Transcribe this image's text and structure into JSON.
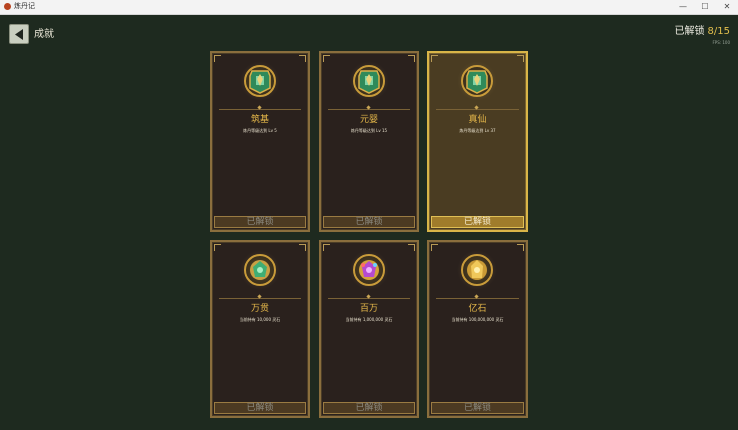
{
  "window": {
    "title": "炼丹记",
    "minimize_glyph": "—",
    "maximize_glyph": "☐",
    "close_glyph": "✕"
  },
  "header": {
    "title": "成就",
    "back_icon": "back-arrow-icon",
    "unlocked_label": "已解锁",
    "unlocked_count": "8/15",
    "fps": "FPS: 100"
  },
  "colors": {
    "background": "#1e2a1f",
    "gold": "#e2bf4d",
    "card_border": "#8a6e3d",
    "highlight_border": "#d9b548"
  },
  "achievements": [
    {
      "name": "筑基",
      "desc": "炼丹等级达到 Lv 5",
      "status": "已解锁",
      "icon": "medal-jade-icon"
    },
    {
      "name": "元婴",
      "desc": "炼丹等级达到 Lv 15",
      "status": "已解锁",
      "icon": "medal-jade-icon"
    },
    {
      "name": "真仙",
      "desc": "炼丹等级达到 Lv 37",
      "status": "已解锁",
      "icon": "medal-jade-icon"
    },
    {
      "name": "万贯",
      "desc": "当前持有 10,000 灵石",
      "status": "已解锁",
      "icon": "medal-jade-gem-icon"
    },
    {
      "name": "百万",
      "desc": "当前持有 1,000,000 灵石",
      "status": "已解锁",
      "icon": "medal-purple-gem-icon"
    },
    {
      "name": "亿石",
      "desc": "当前持有 100,000,000 灵石",
      "status": "已解锁",
      "icon": "medal-gold-gem-icon"
    }
  ]
}
